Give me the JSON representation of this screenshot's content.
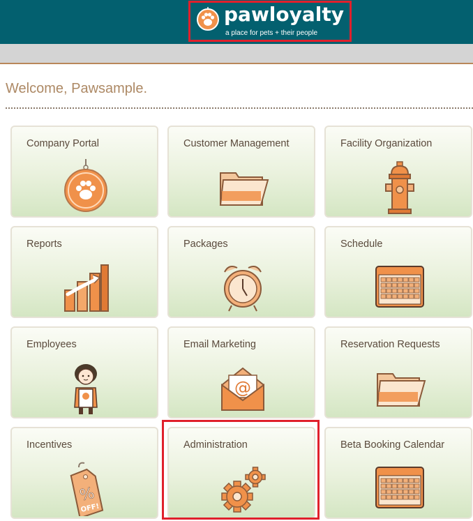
{
  "brand": {
    "name": "pawloyalty",
    "tagline": "a place for pets + their people"
  },
  "welcome": "Welcome, Pawsample.",
  "tiles": [
    {
      "label": "Company Portal",
      "icon": "paw-tag-icon"
    },
    {
      "label": "Customer Management",
      "icon": "folder-icon"
    },
    {
      "label": "Facility Organization",
      "icon": "fire-hydrant-icon"
    },
    {
      "label": "Reports",
      "icon": "bar-chart-icon"
    },
    {
      "label": "Packages",
      "icon": "alarm-clock-icon"
    },
    {
      "label": "Schedule",
      "icon": "calendar-icon"
    },
    {
      "label": "Employees",
      "icon": "employee-icon"
    },
    {
      "label": "Email Marketing",
      "icon": "envelope-icon"
    },
    {
      "label": "Reservation Requests",
      "icon": "folder-icon"
    },
    {
      "label": "Incentives",
      "icon": "discount-tag-icon"
    },
    {
      "label": "Administration",
      "icon": "gears-icon"
    },
    {
      "label": "Beta Booking Calendar",
      "icon": "calendar-icon"
    }
  ],
  "colors": {
    "header": "#03606f",
    "accent_orange": "#f0914a",
    "highlight": "#e0202c",
    "welcome_text": "#ad8965"
  },
  "discount_tag_text": {
    "symbol": "%",
    "word": "OFF!"
  },
  "email_symbol": "@"
}
